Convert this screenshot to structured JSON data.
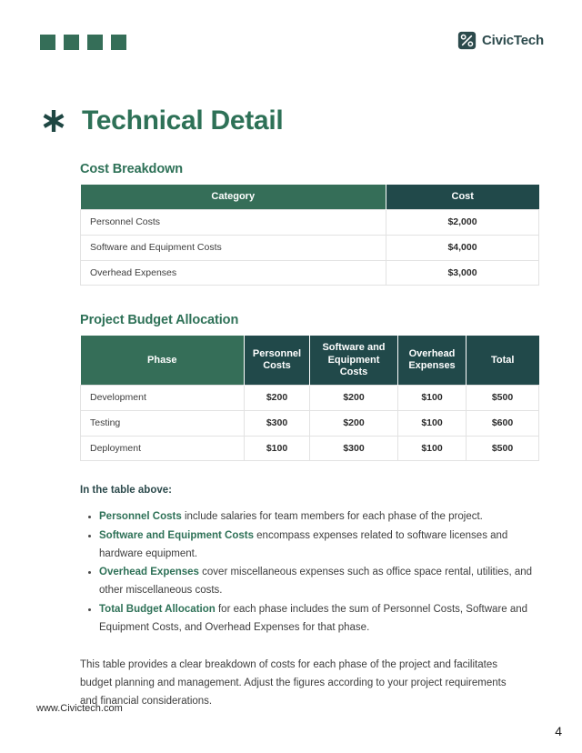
{
  "header": {
    "decor_squares": 4,
    "decor_color": "#356E58",
    "brand_name": "CivicTech",
    "brand_icon": "circuit-node-logo-icon"
  },
  "title": {
    "icon": "asterisk-icon",
    "text": "Technical Detail"
  },
  "theme": {
    "green_light": "#356E58",
    "green_dark": "#21494A",
    "title_green": "#2E7157",
    "heading_navy": "#2C4A4C"
  },
  "cost_breakdown": {
    "heading": "Cost Breakdown",
    "columns": [
      "Category",
      "Cost"
    ],
    "rows": [
      {
        "category": "Personnel Costs",
        "cost": "$2,000"
      },
      {
        "category": "Software and Equipment Costs",
        "cost": "$4,000"
      },
      {
        "category": "Overhead Expenses",
        "cost": "$3,000"
      }
    ]
  },
  "budget_allocation": {
    "heading": "Project Budget Allocation",
    "columns": [
      "Phase",
      "Personnel Costs",
      "Software and Equipment Costs",
      "Overhead Expenses",
      "Total"
    ],
    "rows": [
      {
        "phase": "Development",
        "personnel": "$200",
        "software": "$200",
        "overhead": "$100",
        "total": "$500"
      },
      {
        "phase": "Testing",
        "personnel": "$300",
        "software": "$200",
        "overhead": "$100",
        "total": "$600"
      },
      {
        "phase": "Deployment",
        "personnel": "$100",
        "software": "$300",
        "overhead": "$100",
        "total": "$500"
      }
    ]
  },
  "notes": {
    "intro": "In the table above:",
    "items": [
      {
        "lead": "Personnel Costs",
        "rest": " include salaries for team members for each phase of the project."
      },
      {
        "lead": "Software and Equipment Costs",
        "rest": " encompass expenses related to software licenses and hardware equipment."
      },
      {
        "lead": "Overhead Expenses",
        "rest": " cover miscellaneous expenses such as office space rental, utilities, and other miscellaneous costs."
      },
      {
        "lead": "Total Budget Allocation",
        "rest": " for each phase includes the sum of Personnel Costs, Software and Equipment Costs, and Overhead Expenses for that phase."
      }
    ],
    "closing": "This table provides a clear breakdown of costs for each phase of the project and facilitates budget planning and management. Adjust the figures according to your project requirements and financial considerations."
  },
  "footer": {
    "url": "www.Civictech.com",
    "page_number": "4"
  }
}
